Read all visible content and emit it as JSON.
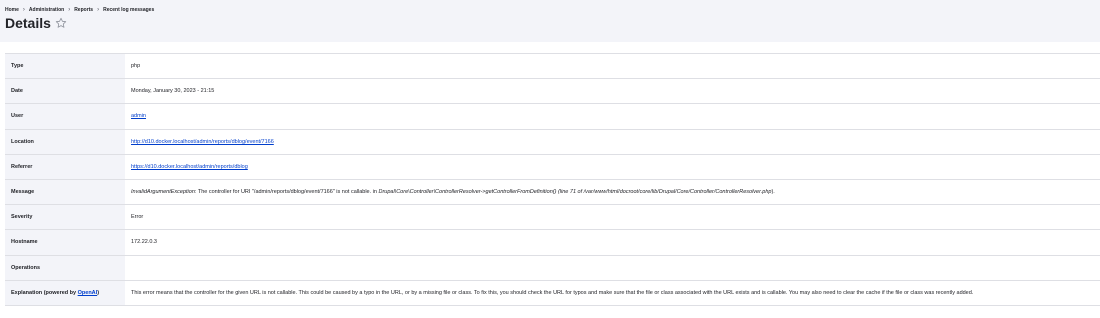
{
  "breadcrumb": {
    "items": [
      "Home",
      "Administration",
      "Reports",
      "Recent log messages"
    ],
    "separator": "›"
  },
  "page": {
    "title": "Details",
    "favorite_icon": "star-outline-icon"
  },
  "details": {
    "type": {
      "label": "Type",
      "value": "php"
    },
    "date": {
      "label": "Date",
      "value": "Monday, January 30, 2023 - 21:15"
    },
    "user": {
      "label": "User",
      "value": "admin"
    },
    "location": {
      "label": "Location",
      "value": "http://d10.docker.localhost/admin/reports/dblog/event/7166"
    },
    "referrer": {
      "label": "Referrer",
      "value": "https://d10.docker.localhost/admin/reports/dblog"
    },
    "message": {
      "label": "Message",
      "exception": "InvalidArgumentException",
      "text": ": The controller for URI \"/admin/reports/dblog/event/7166\" is not callable. in ",
      "method": "Drupal\\Core\\Controller\\ControllerResolver->getControllerFromDefinition()",
      "location": " (line 71 of /var/www/html/docroot/core/lib/Drupal/Core/Controller/ControllerResolver.php",
      "end": ")."
    },
    "severity": {
      "label": "Severity",
      "value": "Error"
    },
    "hostname": {
      "label": "Hostname",
      "value": "172.22.0.3"
    },
    "operations": {
      "label": "Operations",
      "value": ""
    },
    "explanation": {
      "label_prefix": "Explanation (powered by ",
      "label_link": "OpenAI",
      "label_suffix": ")",
      "value": "This error means that the controller for the given URL is not callable. This could be caused by a typo in the URL, or by a missing file or class. To fix this, you should check the URL for typos and make sure that the file or class associated with the URL exists and is callable. You may also need to clear the cache if the file or class was recently added."
    }
  },
  "colors": {
    "header_bg": "#f3f4f9",
    "label_bg": "#f3f4f9",
    "link": "#003ecc",
    "border": "#dedfe4",
    "text": "#232429"
  }
}
